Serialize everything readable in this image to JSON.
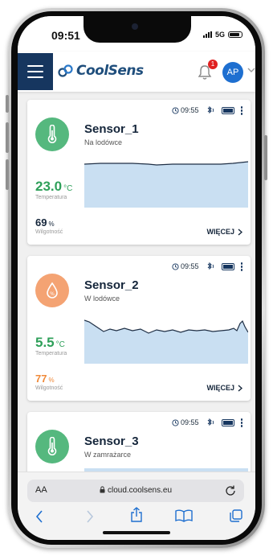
{
  "status_bar": {
    "time": "09:51",
    "network": "5G"
  },
  "header": {
    "brand": "CoolSens",
    "notification_count": "1",
    "avatar_initials": "AP"
  },
  "sensors": [
    {
      "name": "Sensor_1",
      "location": "Na lodówce",
      "time": "09:55",
      "temperature": "23.0",
      "temperature_unit": "°C",
      "temperature_label": "Temperatura",
      "humidity": "69",
      "humidity_unit": "%",
      "humidity_label": "Wilgotność",
      "more_label": "WIĘCEJ",
      "icon_color": "#55b87e",
      "temp_color": "#2fa05a",
      "hum_color": "#14253a"
    },
    {
      "name": "Sensor_2",
      "location": "W lodówce",
      "time": "09:55",
      "temperature": "5.5",
      "temperature_unit": "°C",
      "temperature_label": "Temperatura",
      "humidity": "77",
      "humidity_unit": "%",
      "humidity_label": "Wilgotność",
      "more_label": "WIĘCEJ",
      "icon_color": "#f4a373",
      "temp_color": "#2fa05a",
      "hum_color": "#f08a3a"
    },
    {
      "name": "Sensor_3",
      "location": "W zamrażarce",
      "time": "09:55",
      "icon_color": "#55b87e"
    }
  ],
  "browser": {
    "aa_label": "AA",
    "url": "cloud.coolsens.eu"
  },
  "colors": {
    "navy": "#16365f",
    "accent_blue": "#1e6fd0",
    "chart_fill": "#c9dff2",
    "chart_line": "#1f2f45",
    "alert_red": "#d13030"
  }
}
